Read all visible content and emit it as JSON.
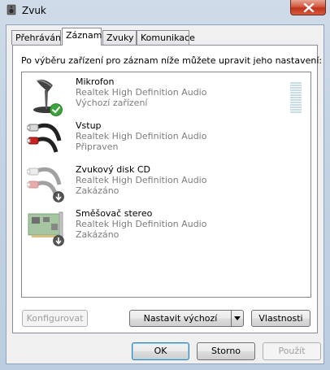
{
  "window": {
    "title": "Zvuk"
  },
  "tabs": [
    {
      "label": "Přehrávání"
    },
    {
      "label": "Záznam"
    },
    {
      "label": "Zvuky"
    },
    {
      "label": "Komunikace"
    }
  ],
  "instruction": "Po výběru zařízení pro záznam níže můžete upravit jeho nastavení:",
  "devices": [
    {
      "name": "Mikrofon",
      "driver": "Realtek High Definition Audio",
      "status": "Výchozí zařízení",
      "icon": "microphone-icon",
      "badge": "check-badge-icon"
    },
    {
      "name": "Vstup",
      "driver": "Realtek High Definition Audio",
      "status": "Připraven",
      "icon": "rca-cable-icon",
      "badge": ""
    },
    {
      "name": "Zvukový disk CD",
      "driver": "Realtek High Definition Audio",
      "status": "Zakázáno",
      "icon": "rca-cable-icon",
      "badge": "disabled-badge-icon"
    },
    {
      "name": "Směšovač stereo",
      "driver": "Realtek High Definition Audio",
      "status": "Zakázáno",
      "icon": "sound-card-icon",
      "badge": "disabled-badge-icon"
    }
  ],
  "buttons": {
    "configure": "Konfigurovat",
    "set_default": "Nastavit výchozí",
    "properties": "Vlastnosti",
    "ok": "OK",
    "cancel": "Storno",
    "apply": "Použít"
  },
  "colors": {
    "accent": "#3c7fb1",
    "close_button": "#c0321b",
    "disabled_text": "#a0a0a0",
    "secondary_text": "#7d7d7d"
  }
}
